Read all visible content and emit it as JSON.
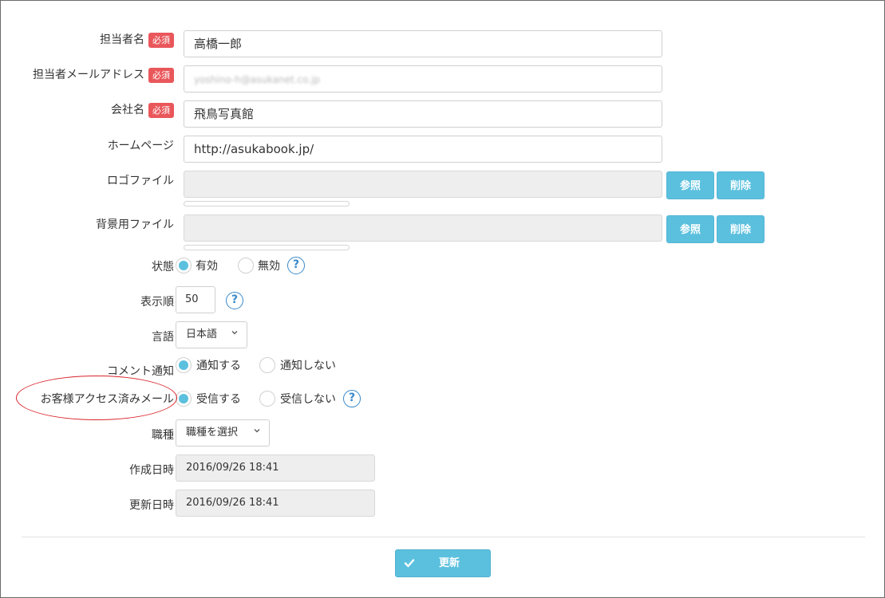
{
  "required_badge": "必須",
  "fields": {
    "tantou_name": {
      "label": "担当者名",
      "value": "高橋一郎"
    },
    "tantou_email": {
      "label": "担当者メールアドレス",
      "value": "yoshino-h@asukanet.co.jp"
    },
    "company": {
      "label": "会社名",
      "value": "飛鳥写真館"
    },
    "homepage": {
      "label": "ホームページ",
      "value": "http://asukabook.jp/"
    },
    "logo_file": {
      "label": "ロゴファイル"
    },
    "bg_file": {
      "label": "背景用ファイル"
    },
    "status": {
      "label": "状態",
      "options": [
        "有効",
        "無効"
      ],
      "selected": 0
    },
    "display_order": {
      "label": "表示順",
      "value": "50"
    },
    "language": {
      "label": "言語",
      "value": "日本語"
    },
    "comment_notify": {
      "label": "コメント通知",
      "options": [
        "通知する",
        "通知しない"
      ],
      "selected": 0
    },
    "access_mail": {
      "label": "お客様アクセス済みメール",
      "options": [
        "受信する",
        "受信しない"
      ],
      "selected": 0
    },
    "job_type": {
      "label": "職種",
      "value": "職種を選択"
    },
    "created": {
      "label": "作成日時",
      "value": "2016/09/26 18:41"
    },
    "updated": {
      "label": "更新日時",
      "value": "2016/09/26 18:41"
    }
  },
  "buttons": {
    "browse": "参照",
    "delete": "削除",
    "update": "更新"
  },
  "help_icon": "?",
  "colors": {
    "accent": "#5bc0de",
    "required": "#e9575b",
    "help": "#3a89c9",
    "annotation": "#d9232a"
  }
}
